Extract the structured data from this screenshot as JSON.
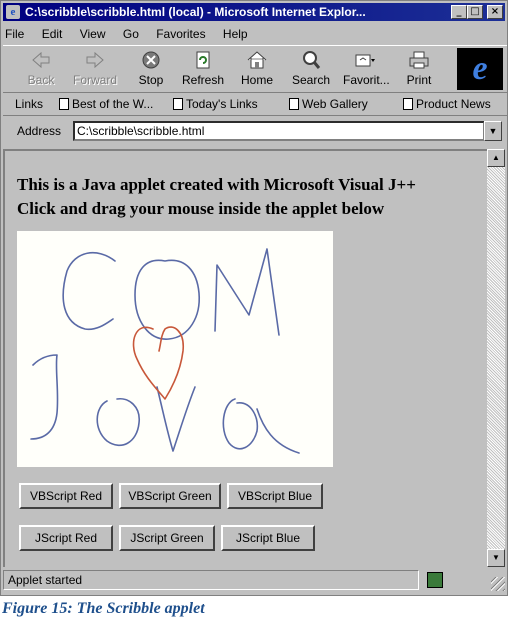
{
  "window": {
    "title": "C:\\scribble\\scribble.html (local) - Microsoft Internet Explor...",
    "minimize": "_",
    "maximize": "□",
    "close": "×"
  },
  "menu": [
    "File",
    "Edit",
    "View",
    "Go",
    "Favorites",
    "Help"
  ],
  "toolbar": {
    "back": "Back",
    "forward": "Forward",
    "stop": "Stop",
    "refresh": "Refresh",
    "home": "Home",
    "search": "Search",
    "favorites": "Favorit...",
    "print": "Print",
    "logo_letter": "e"
  },
  "links": {
    "label": "Links",
    "items": [
      "Best of the W...",
      "Today's Links",
      "Web Gallery",
      "Product News"
    ]
  },
  "address": {
    "label": "Address",
    "value": "C:\\scribble\\scribble.html"
  },
  "page": {
    "heading_line1": "This is a Java applet created with Microsoft Visual J++",
    "heading_line2": "Click and drag your mouse inside the applet below"
  },
  "buttons": {
    "vb_red": "VBScript Red",
    "vb_green": "VBScript Green",
    "vb_blue": "VBScript Blue",
    "js_red": "JScript Red",
    "js_green": "JScript Green",
    "js_blue": "JScript Blue"
  },
  "colors": {
    "scribble_blue": "#5a6aa6",
    "scribble_red": "#c8583a",
    "title_bar": "#000080",
    "caption": "#1e4f8c"
  },
  "status": {
    "text": "Applet started"
  },
  "caption": "Figure 15: The Scribble applet"
}
